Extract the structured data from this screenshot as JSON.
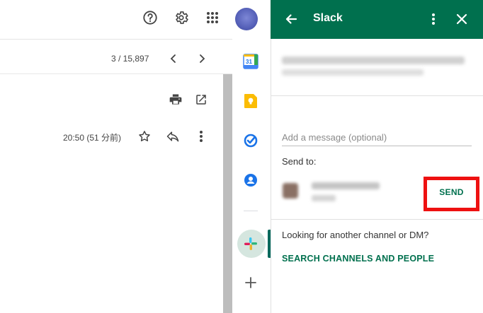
{
  "pager": {
    "count": "3 / 15,897"
  },
  "message": {
    "timestamp": "20:50 (51 分前)"
  },
  "panel": {
    "title": "Slack",
    "message_placeholder": "Add a message (optional)",
    "send_to_label": "Send to:",
    "send_label": "SEND",
    "looking_text": "Looking for another channel or DM?",
    "search_link": "SEARCH CHANNELS AND PEOPLE"
  },
  "icons": {
    "help": "help-circle-icon",
    "settings": "gear-icon",
    "apps": "apps-grid-icon",
    "older": "chevron-left-icon",
    "newer": "chevron-right-icon",
    "print": "print-icon",
    "open_new": "open-in-new-icon",
    "star": "star-icon",
    "reply": "reply-icon",
    "more": "more-vert-icon",
    "calendar": "calendar-icon",
    "keep": "keep-icon",
    "tasks": "tasks-icon",
    "contacts": "contacts-icon",
    "slack": "slack-icon",
    "add": "plus-icon",
    "back": "arrow-back-icon",
    "close": "close-icon"
  },
  "colors": {
    "slack_green": "#00704e",
    "highlight_red": "#ee1111",
    "avatar_blue": "#5560b8"
  }
}
